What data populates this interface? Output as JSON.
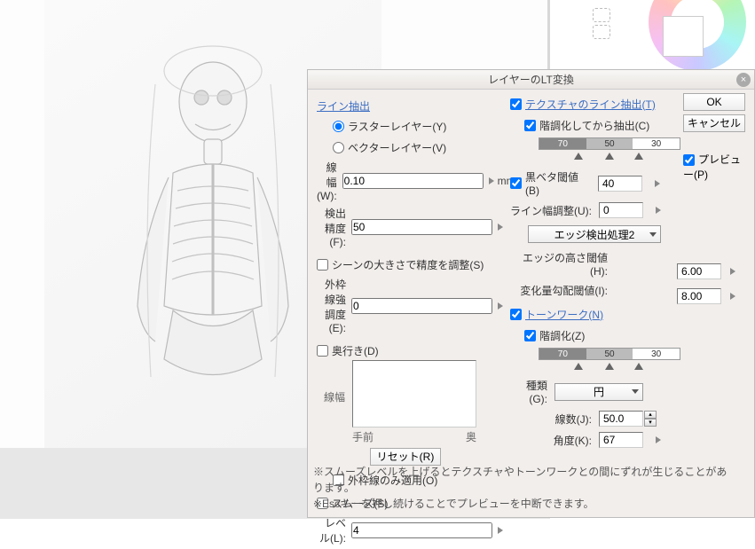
{
  "dialog": {
    "title": "レイヤーのLT変換",
    "buttons": {
      "ok": "OK",
      "cancel": "キャンセル",
      "preview": "プレビュー(P)"
    }
  },
  "left": {
    "line_extract": "ライン抽出",
    "raster": "ラスターレイヤー(Y)",
    "vector": "ベクターレイヤー(V)",
    "layer_type": "raster",
    "line_width": {
      "label": "線幅(W):",
      "value": "0.10",
      "unit": "mm"
    },
    "detect_acc": {
      "label": "検出精度(F):",
      "value": "50"
    },
    "scene_adjust": {
      "label": "シーンの大きさで精度を調整(S)",
      "checked": false
    },
    "outline_strength": {
      "label": "外枠線強調度(E):",
      "value": "0"
    },
    "depth": {
      "label": "奥行き(D)",
      "checked": false
    },
    "graph_vlabel": "線幅",
    "graph_left": "手前",
    "graph_right": "奥",
    "reset": "リセット(R)",
    "outline_only": {
      "label": "外枠線のみ適用(O)",
      "checked": false
    },
    "smooth": {
      "label": "スムーズ(S)",
      "checked": false
    },
    "level": {
      "label": "レベル(L):",
      "value": "4"
    }
  },
  "right": {
    "texture_line": {
      "label": "テクスチャのライン抽出(T)",
      "checked": true
    },
    "posterize_c": {
      "label": "階調化してから抽出(C)",
      "checked": true
    },
    "slider_c": [
      "70",
      "50",
      "30"
    ],
    "black_thresh": {
      "label": "黒ベタ閾値(B)",
      "value": "40",
      "checked": true
    },
    "line_width_adj": {
      "label": "ライン幅調整(U):",
      "value": "0"
    },
    "edge_method": {
      "label": "エッジ検出処理2"
    },
    "edge_height": {
      "label": "エッジの高さ閾値(H):",
      "value": "6.00"
    },
    "change_gradient": {
      "label": "変化量勾配閾値(I):",
      "value": "8.00"
    },
    "tonework": {
      "label": "トーンワーク(N)",
      "checked": true
    },
    "posterize_z": {
      "label": "階調化(Z)",
      "checked": true
    },
    "slider_z": [
      "70",
      "50",
      "30"
    ],
    "type": {
      "label": "種類(G):",
      "value": "円"
    },
    "lines": {
      "label": "線数(J):",
      "value": "50.0"
    },
    "angle": {
      "label": "角度(K):",
      "value": "67"
    }
  },
  "hints": {
    "h1": "※スムーズレベルを上げるとテクスチャやトーンワークとの間にずれが生じることがあります。",
    "h2": "※Escキーを押し続けることでプレビューを中断できます。"
  }
}
